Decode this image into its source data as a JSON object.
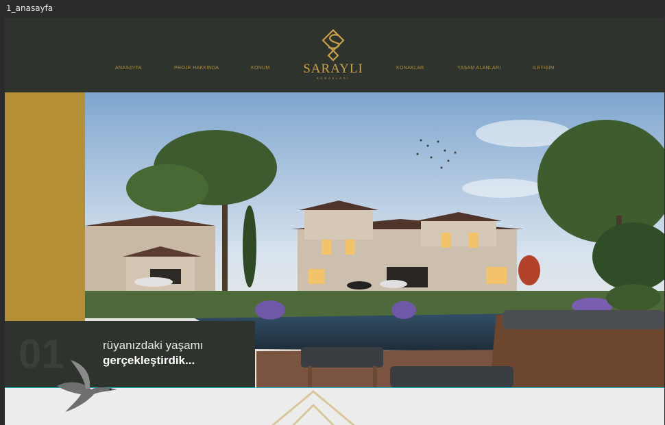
{
  "window": {
    "title": "1_anasayfa"
  },
  "nav": {
    "items": [
      {
        "label": "ANASAYFA"
      },
      {
        "label": "PROJE HAKKINDA"
      },
      {
        "label": "KONUM"
      },
      {
        "label": "KONAKLAR"
      },
      {
        "label": "YAŞAM ALANLARI"
      },
      {
        "label": "İLETİŞİM"
      }
    ]
  },
  "logo": {
    "name": "SARAYLI",
    "tagline": "KONAKLARI"
  },
  "hero": {
    "slide_number": "01",
    "caption_line1": "rüyanızdaki yaşamı",
    "caption_line2": "gerçekleştirdik..."
  },
  "colors": {
    "dark": "#2f332d",
    "gold": "#b58f35",
    "accent_line": "#19c3d6"
  }
}
